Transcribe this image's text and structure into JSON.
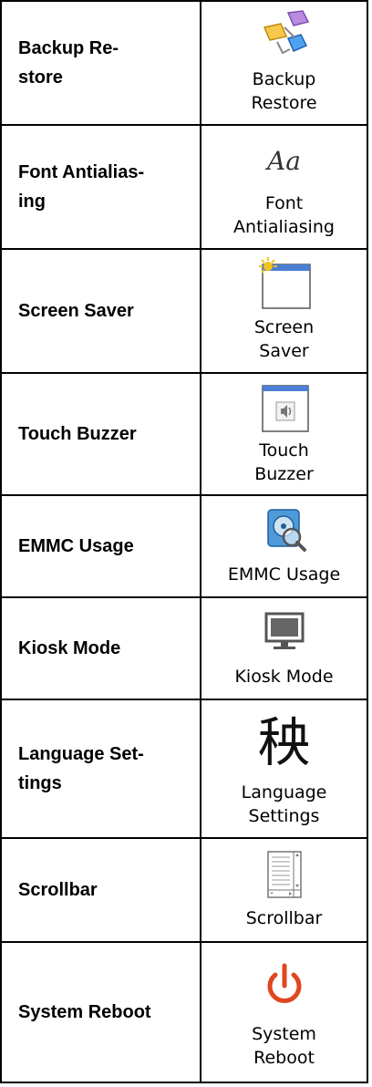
{
  "rows": [
    {
      "label": "Backup Re-store",
      "label_line1": "Backup Re-",
      "label_line2": "store",
      "icon": "backup-restore-icon",
      "caption_line1": "Backup",
      "caption_line2": "Restore"
    },
    {
      "label": "Font Antialias-ing",
      "label_line1": "Font Antialias-",
      "label_line2": "ing",
      "icon": "font-aa-icon",
      "icon_text": "Aa",
      "caption_line1": "Font",
      "caption_line2": "Antialiasing"
    },
    {
      "label": "Screen Saver",
      "icon": "screen-saver-icon",
      "caption_line1": "Screen",
      "caption_line2": "Saver"
    },
    {
      "label": "Touch Buzzer",
      "icon": "speaker-icon",
      "caption_line1": "Touch",
      "caption_line2": "Buzzer"
    },
    {
      "label": "EMMC Usage",
      "icon": "disk-magnifier-icon",
      "caption_line1": "EMMC Usage"
    },
    {
      "label": "Kiosk Mode",
      "icon": "monitor-icon",
      "caption_line1": "Kiosk Mode"
    },
    {
      "label": "Language Set-tings",
      "label_line1": "Language Set-",
      "label_line2": "tings",
      "icon": "chinese-character-icon",
      "icon_text": "秧",
      "caption_line1": "Language",
      "caption_line2": "Settings"
    },
    {
      "label": "Scrollbar",
      "icon": "scrollbar-icon",
      "caption_line1": "Scrollbar"
    },
    {
      "label": "System Reboot",
      "icon": "power-icon",
      "caption_line1": "System",
      "caption_line2": "Reboot"
    }
  ],
  "colors": {
    "border": "#000000",
    "power": "#e0461e",
    "window_title": "#4a7fd4",
    "sun": "#f4c21a"
  }
}
